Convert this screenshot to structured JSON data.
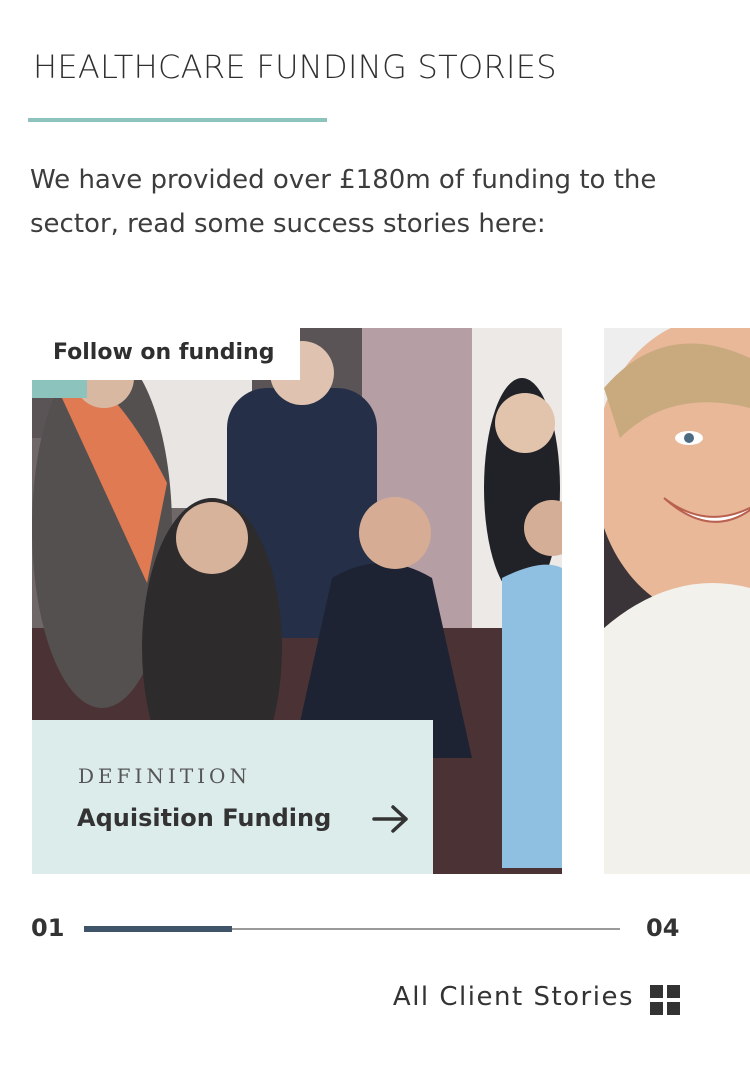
{
  "header": {
    "title": "HEALTHCARE FUNDING STORIES",
    "intro": "We have provided over £180m of funding to the sector, read some success stories here:"
  },
  "carousel": {
    "slides": [
      {
        "tag": "Follow on funding",
        "kicker": "DEFINITION",
        "title": "Aquisition Funding",
        "image": "group photo of team members seated on a sofa"
      },
      {
        "image": "smiling boy close-up"
      }
    ],
    "current_index": "01",
    "total_index": "04",
    "progress": 0.276
  },
  "footer": {
    "all_stories_label": "All Client Stories",
    "icon": "grid-icon"
  },
  "colors": {
    "accent": "#8cc3bd",
    "panel": "#dcecea",
    "progress": "#3f5468"
  }
}
